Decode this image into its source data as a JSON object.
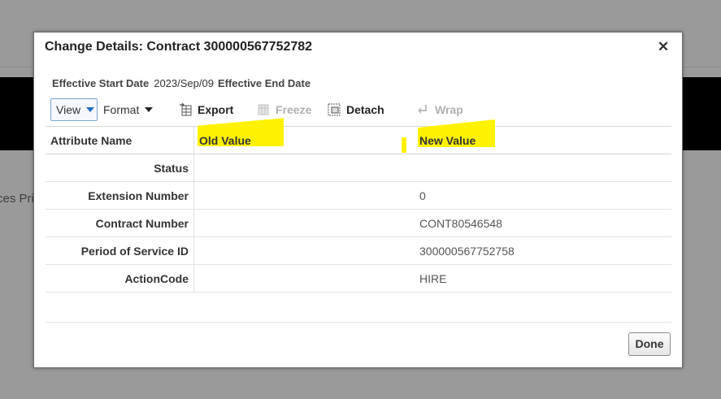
{
  "background": {
    "partial_text": "ces Pri"
  },
  "dialog": {
    "title": "Change Details: Contract 300000567752782",
    "close_glyph": "✕",
    "effective_start_label": "Effective Start Date",
    "effective_start_value": "2023/Sep/09",
    "effective_end_label": "Effective End Date"
  },
  "toolbar": {
    "view_label": "View",
    "format_label": "Format",
    "export_label": "Export",
    "freeze_label": "Freeze",
    "detach_label": "Detach",
    "wrap_label": "Wrap"
  },
  "table": {
    "headers": [
      "Attribute Name",
      "Old Value",
      "New Value"
    ],
    "rows": [
      {
        "attribute": "Status",
        "old": "",
        "new": ""
      },
      {
        "attribute": "Extension Number",
        "old": "",
        "new": "0"
      },
      {
        "attribute": "Contract Number",
        "old": "",
        "new": "CONT80546548"
      },
      {
        "attribute": "Period of Service ID",
        "old": "",
        "new": "300000567752758"
      },
      {
        "attribute": "ActionCode",
        "old": "",
        "new": "HIRE"
      }
    ]
  },
  "footer": {
    "done_label": "Done"
  },
  "colors": {
    "highlight": "#fff200",
    "accent": "#1f6fc5"
  }
}
